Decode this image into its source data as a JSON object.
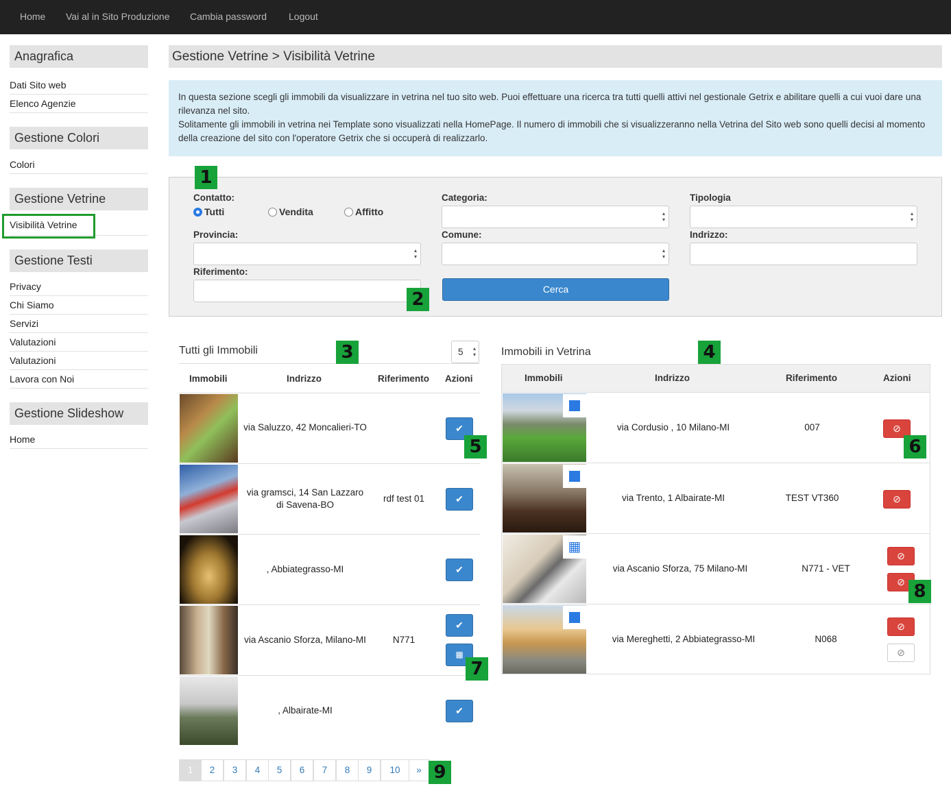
{
  "topnav": {
    "items": [
      "Home",
      "Vai al in Sito Produzione",
      "Cambia password",
      "Logout"
    ]
  },
  "sidebar": {
    "sections": [
      {
        "title": "Anagrafica",
        "items": [
          "Dati Sito web",
          "Elenco Agenzie"
        ]
      },
      {
        "title": "Gestione Colori",
        "items": [
          "Colori"
        ]
      },
      {
        "title": "Gestione Vetrine",
        "items": [
          "Visibilità Vetrine"
        ]
      },
      {
        "title": "Gestione Testi",
        "items": [
          "Privacy",
          "Chi Siamo",
          "Servizi",
          "Valutazioni",
          "Valutazioni",
          "Lavora con Noi"
        ]
      },
      {
        "title": "Gestione Slideshow",
        "items": [
          "Home"
        ]
      }
    ]
  },
  "page_title": "Gestione Vetrine > Visibilità Vetrine",
  "info": {
    "p1": "In questa sezione scegli gli immobili da visualizzare in vetrina nel tuo sito web. Puoi effettuare una ricerca tra tutti quelli attivi nel gestionale Getrix e abilitare quelli a cui vuoi dare una rilevanza nel sito.",
    "p2": "Solitamente gli immobili in vetrina nei Template sono visualizzati nella HomePage. Il numero di immobili che si visualizzeranno nella Vetrina del Sito web sono quelli decisi al momento della creazione del sito con l'operatore Getrix che si occuperà di realizzarlo."
  },
  "search": {
    "contatto_label": "Contatto:",
    "radio_tutti": "Tutti",
    "radio_vendita": "Vendita",
    "radio_affitto": "Affitto",
    "categoria_label": "Categoria:",
    "tipologia_label": "Tipologia",
    "provincia_label": "Provincia:",
    "comune_label": "Comune:",
    "indirizzo_label": "Indrizzo:",
    "riferimento_label": "Riferimento:",
    "cerca": "Cerca"
  },
  "left_table": {
    "title": "Tutti gli Immobili",
    "per_page": "5",
    "headers": {
      "immobili": "Immobili",
      "indirizzo": "Indrizzo",
      "riferimento": "Riferimento",
      "azioni": "Azioni"
    },
    "rows": [
      {
        "indirizzo": "via Saluzzo, 42 Moncalieri-TO",
        "riferimento": ""
      },
      {
        "indirizzo": "via gramsci, 14 San Lazzaro di Savena-BO",
        "riferimento": "rdf test 01"
      },
      {
        "indirizzo": ", Abbiategrasso-MI",
        "riferimento": ""
      },
      {
        "indirizzo": "via Ascanio Sforza, Milano-MI",
        "riferimento": "N771"
      },
      {
        "indirizzo": ", Albairate-MI",
        "riferimento": ""
      }
    ]
  },
  "right_table": {
    "title": "Immobili in Vetrina",
    "headers": {
      "immobili": "Immobili",
      "indirizzo": "Indrizzo",
      "riferimento": "Riferimento",
      "azioni": "Azioni"
    },
    "rows": [
      {
        "indirizzo": "via Cordusio , 10 Milano-MI",
        "riferimento": "007"
      },
      {
        "indirizzo": "via Trento, 1 Albairate-MI",
        "riferimento": "TEST VT360"
      },
      {
        "indirizzo": "via Ascanio Sforza, 75 Milano-MI",
        "riferimento": "N771 - VET"
      },
      {
        "indirizzo": "via Mereghetti, 2 Abbiategrasso-MI",
        "riferimento": "N068"
      }
    ]
  },
  "pagination": {
    "pages": [
      "1",
      "2",
      "3",
      "4",
      "5",
      "6",
      "7",
      "8",
      "9",
      "10"
    ],
    "next": "»",
    "active": "1"
  },
  "badges": [
    "1",
    "2",
    "3",
    "4",
    "5",
    "6",
    "7",
    "8",
    "9"
  ],
  "colors": {
    "accent": "#3a87cd",
    "danger": "#d9453d",
    "badge": "#18a23a",
    "info_bg": "#d9edf7"
  }
}
